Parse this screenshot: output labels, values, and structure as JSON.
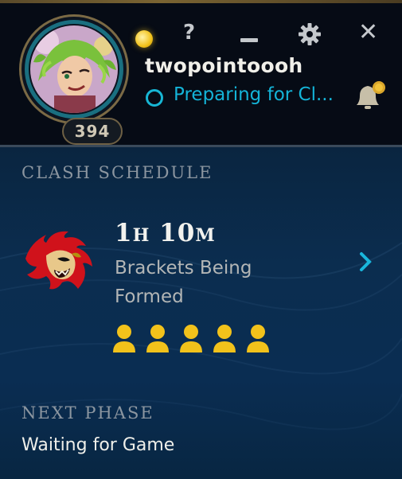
{
  "header": {
    "username": "twopointoooh",
    "status_text": "Preparing for Cl...",
    "level": "394",
    "help_glyph": "?",
    "close_glyph": "✕",
    "icons": [
      "orb-icon",
      "help-icon",
      "minimize-icon",
      "gear-icon",
      "close-icon",
      "notification-bell-icon"
    ]
  },
  "clash": {
    "section_title": "CLASH SCHEDULE",
    "timer_hours": "1",
    "timer_hours_unit": "H",
    "timer_minutes": "10",
    "timer_minutes_unit": "M",
    "phase_line1": "Brackets Being",
    "phase_line2": "Formed",
    "players": 5
  },
  "next_phase": {
    "section_title": "NEXT PHASE",
    "value": "Waiting for Game"
  },
  "colors": {
    "accent_teal": "#14b4d8",
    "gold": "#f2c21b",
    "clash_red": "#d0121b"
  }
}
